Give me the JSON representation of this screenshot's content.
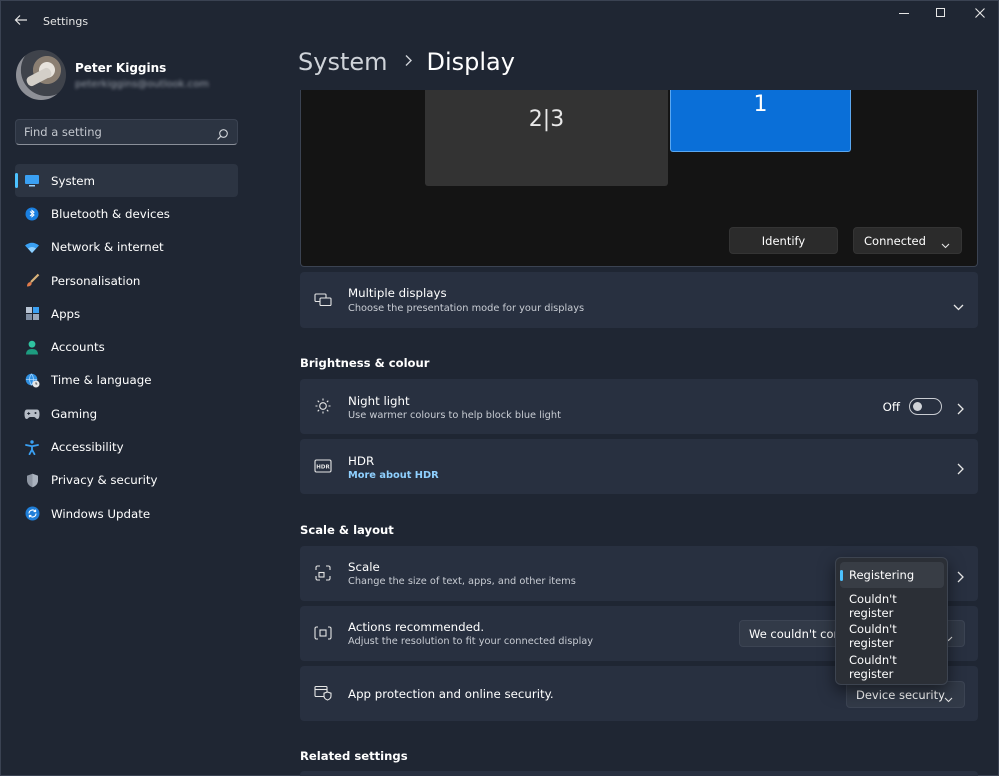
{
  "window": {
    "title": "Settings"
  },
  "profile": {
    "name": "Peter Kiggins",
    "email": "peterkiggins@outlook.com"
  },
  "search": {
    "placeholder": "Find a setting"
  },
  "sidebar": {
    "items": [
      {
        "label": "System",
        "icon": "system-icon",
        "active": true
      },
      {
        "label": "Bluetooth & devices",
        "icon": "bluetooth-icon"
      },
      {
        "label": "Network & internet",
        "icon": "wifi-icon"
      },
      {
        "label": "Personalisation",
        "icon": "brush-icon"
      },
      {
        "label": "Apps",
        "icon": "apps-icon"
      },
      {
        "label": "Accounts",
        "icon": "person-icon"
      },
      {
        "label": "Time & language",
        "icon": "globe-clock-icon"
      },
      {
        "label": "Gaming",
        "icon": "gamepad-icon"
      },
      {
        "label": "Accessibility",
        "icon": "accessibility-icon"
      },
      {
        "label": "Privacy & security",
        "icon": "shield-icon"
      },
      {
        "label": "Windows Update",
        "icon": "update-icon"
      }
    ]
  },
  "breadcrumb": {
    "parent": "System",
    "current": "Display"
  },
  "arrangement": {
    "monitor_a": "2|3",
    "monitor_b": "1",
    "identify_label": "Identify",
    "connected_label": "Connected"
  },
  "multiple_displays": {
    "title": "Multiple displays",
    "subtitle": "Choose the presentation mode for your displays"
  },
  "sections": {
    "brightness": "Brightness & colour",
    "scale_layout": "Scale & layout",
    "related": "Related settings"
  },
  "night_light": {
    "title": "Night light",
    "subtitle": "Use warmer colours to help block blue light",
    "state": "Off"
  },
  "hdr": {
    "title": "HDR",
    "link": "More about HDR"
  },
  "scale": {
    "title": "Scale",
    "subtitle": "Change the size of text, apps, and other items"
  },
  "actions": {
    "title": "Actions recommended.",
    "subtitle": "Adjust the resolution to fit your connected display",
    "dropdown_value": "We couldn't connect"
  },
  "app_protection": {
    "title": "App protection and online security.",
    "dropdown_value": "Device security"
  },
  "popup": {
    "options": [
      "Registering",
      "Couldn't register",
      "Couldn't register",
      "Couldn't register"
    ]
  },
  "colors": {
    "accent": "#4cc2ff",
    "background": "#1f2633",
    "card": "#283040",
    "monitor_selected": "#0a6fd8"
  }
}
